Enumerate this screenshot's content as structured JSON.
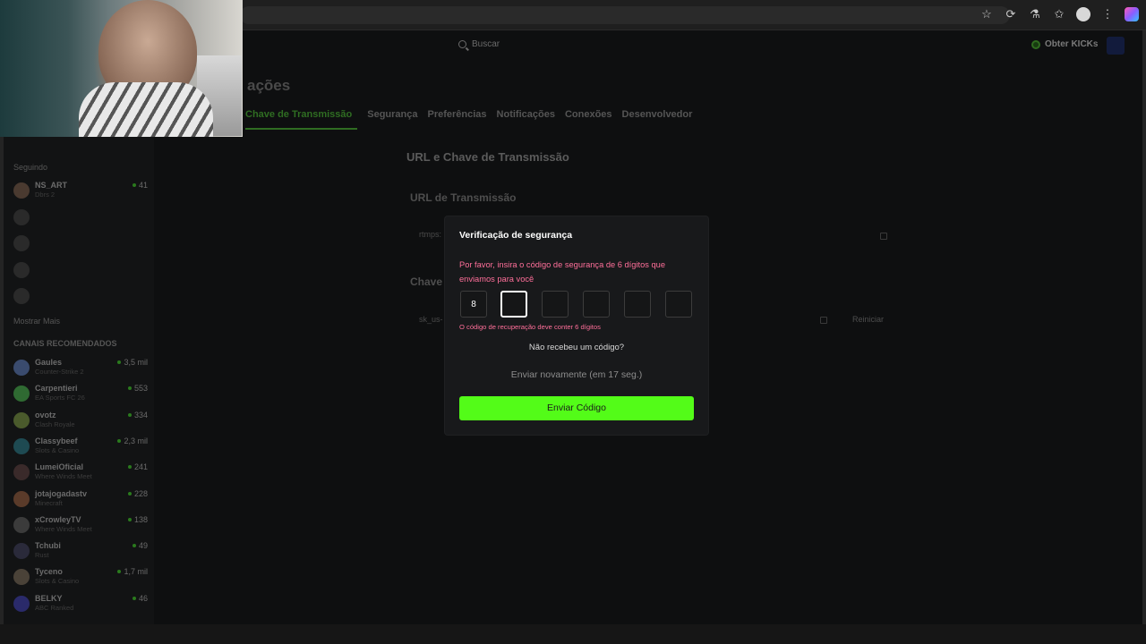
{
  "browser": {
    "icons": [
      "star-icon",
      "extension-icon",
      "extensions-puzzle-icon",
      "favorites-icon",
      "profile-avatar",
      "more-icon",
      "copilot-icon"
    ]
  },
  "topnav": {
    "search_placeholder": "Buscar",
    "kicks_label": "Obter KICKs"
  },
  "settings": {
    "page_title_visible": "ações",
    "tabs": [
      {
        "label": "Chave de Transmissão",
        "active": true
      },
      {
        "label": "Segurança"
      },
      {
        "label": "Preferências"
      },
      {
        "label": "Notificações"
      },
      {
        "label": "Conexões"
      },
      {
        "label": "Desenvolvedor"
      }
    ],
    "section_title": "URL e Chave de Transmissão",
    "url_heading": "URL de Transmissão",
    "url_value": "rtmps:",
    "key_heading": "Chave",
    "key_value": "sk_us-",
    "reset_label": "Reiniciar"
  },
  "sidebar": {
    "following_heading": "Seguindo",
    "following": [
      {
        "name": "NS_ART",
        "sub": "Dbrs 2",
        "viewers": "41"
      }
    ],
    "show_more": "Mostrar Mais",
    "recommended_heading": "Canais recomendados",
    "recommended": [
      {
        "name": "Gaules",
        "sub": "Counter-Strike 2",
        "viewers": "3,5 mil",
        "color": "#3a4b6e"
      },
      {
        "name": "Carpentieri",
        "sub": "EA Sports FC 26",
        "viewers": "553",
        "color": "#2f6a32"
      },
      {
        "name": "ovotz",
        "sub": "Clash Royale",
        "viewers": "334",
        "color": "#4a5a2c"
      },
      {
        "name": "Classybeef",
        "sub": "Slots & Casino",
        "viewers": "2,3 mil",
        "color": "#1e4a52"
      },
      {
        "name": "LumeiOficial",
        "sub": "Where Winds Meet",
        "viewers": "241",
        "color": "#3a2a2a"
      },
      {
        "name": "jotajogadastv",
        "sub": "Minecraft",
        "viewers": "228",
        "color": "#5a3b2a"
      },
      {
        "name": "xCrowleyTV",
        "sub": "Where Winds Meet",
        "viewers": "138",
        "color": "#3b3b3b"
      },
      {
        "name": "Tchubi",
        "sub": "Rust",
        "viewers": "49",
        "color": "#2a2a3a"
      },
      {
        "name": "Tyceno",
        "sub": "Slots & Casino",
        "viewers": "1,7 mil",
        "color": "#4a4238"
      },
      {
        "name": "BELKY",
        "sub": "ABC Ranked",
        "viewers": "46",
        "color": "#2a2a6a"
      }
    ]
  },
  "modal": {
    "title": "Verificação de segurança",
    "message": "Por favor, insira o código de segurança de 6 dígitos que enviamos para você",
    "code_digits": [
      "8",
      "",
      "",
      "",
      "",
      ""
    ],
    "error": "O código de recuperação deve conter 6 dígitos",
    "no_code": "Não recebeu um código?",
    "resend": "Enviar novamente (em 17 seg.)",
    "submit_label": "Enviar Código",
    "accent_color": "#53fc18",
    "error_color": "#ff6f9a"
  }
}
